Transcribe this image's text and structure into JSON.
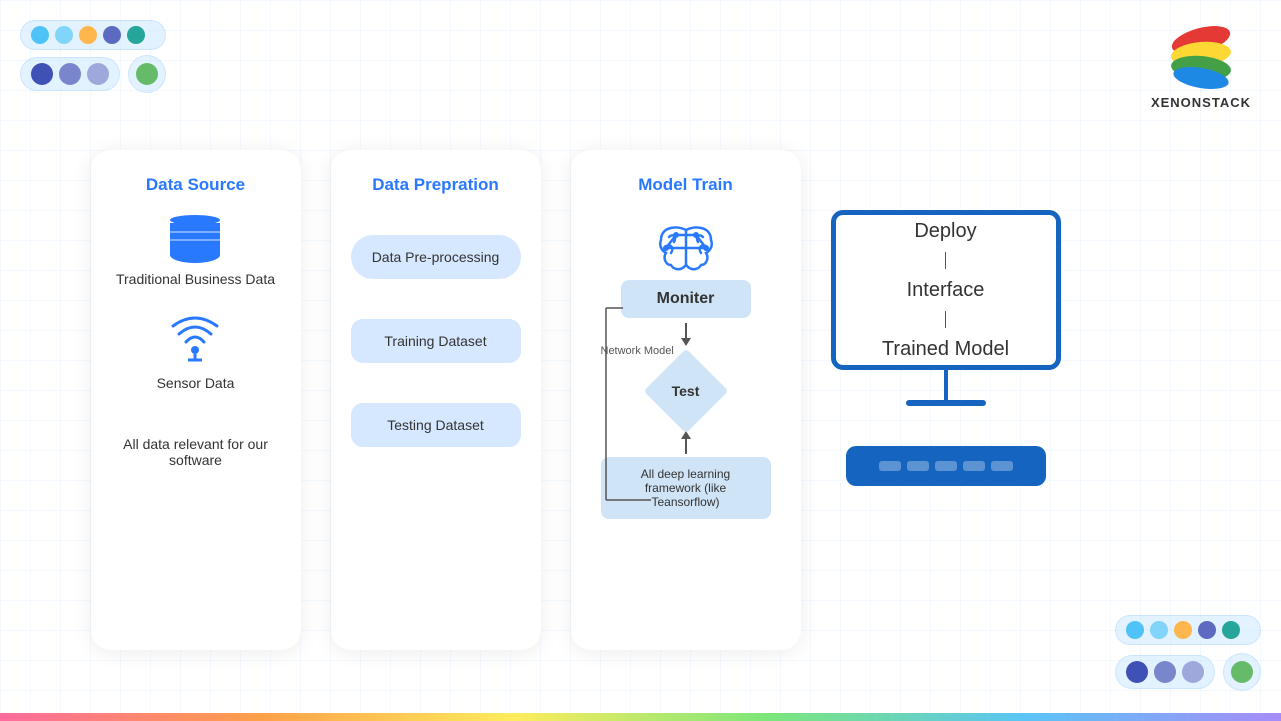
{
  "logo": {
    "text": "XENONSTACK"
  },
  "topDots": {
    "row1": [
      {
        "color": "#4fc3f7",
        "size": 18
      },
      {
        "color": "#81d4fa",
        "size": 18
      },
      {
        "color": "#ffb74d",
        "size": 18
      },
      {
        "color": "#5c6bc0",
        "size": 18
      },
      {
        "color": "#26a69a",
        "size": 18
      }
    ],
    "row2": [
      {
        "color": "#3f51b5",
        "size": 22
      },
      {
        "color": "#7986cb",
        "size": 22
      },
      {
        "color": "#9fa8da",
        "size": 22
      }
    ],
    "single": {
      "color": "#66bb6a",
      "size": 22
    }
  },
  "cards": {
    "dataSource": {
      "title": "Data Source",
      "items": [
        {
          "label": "Traditional Business Data"
        },
        {
          "label": "Sensor Data"
        },
        {
          "label": "All data relevant for our software"
        }
      ]
    },
    "dataPrep": {
      "title": "Data Prepration",
      "items": [
        {
          "label": "Data Pre-processing",
          "oval": true
        },
        {
          "label": "Training Dataset",
          "oval": false
        },
        {
          "label": "Testing Dataset",
          "oval": false
        }
      ]
    },
    "modelTrain": {
      "title": "Model Train",
      "monitorLabel": "Moniter",
      "testLabel": "Test",
      "networkLabel": "Network Model",
      "dlLabel": "All deep learning framework (like Teansorflow)"
    },
    "deploy": {
      "line1": "Deploy",
      "line2": "Interface",
      "line3": "Trained Model"
    }
  }
}
